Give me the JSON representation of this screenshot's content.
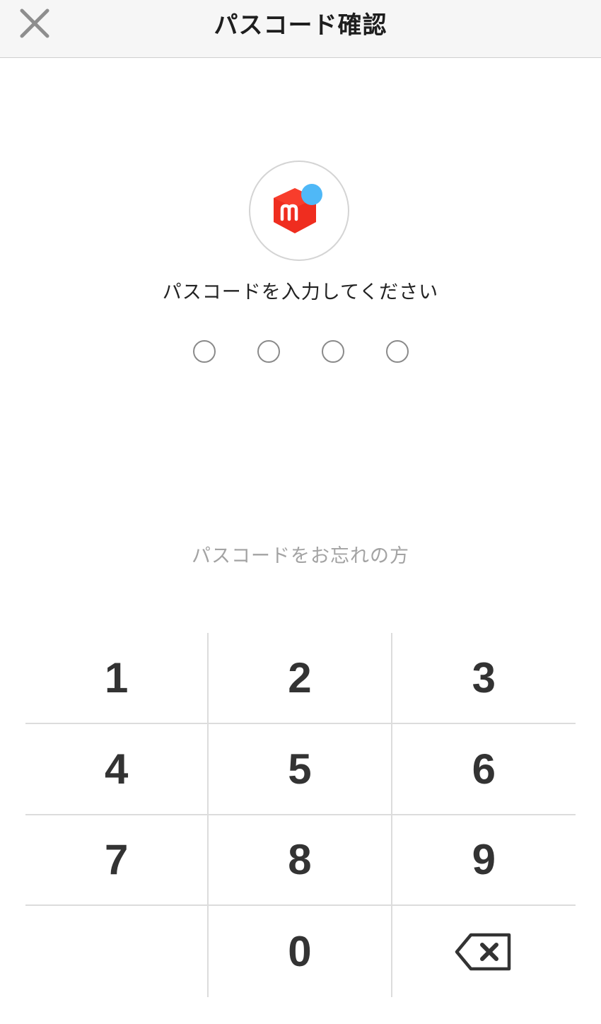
{
  "header": {
    "title": "パスコード確認",
    "close_icon": "close-icon"
  },
  "logo": {
    "icon": "mercari-logo-icon",
    "brand_red": "#ef2d1f",
    "badge_blue": "#4fb8f7"
  },
  "prompt": "パスコードを入力してください",
  "passcode": {
    "length": 4,
    "filled": 0
  },
  "forgot_link": "パスコードをお忘れの方",
  "keypad": {
    "keys": [
      "1",
      "2",
      "3",
      "4",
      "5",
      "6",
      "7",
      "8",
      "9",
      "",
      "0",
      "⌫"
    ],
    "backspace_icon": "backspace-icon"
  }
}
